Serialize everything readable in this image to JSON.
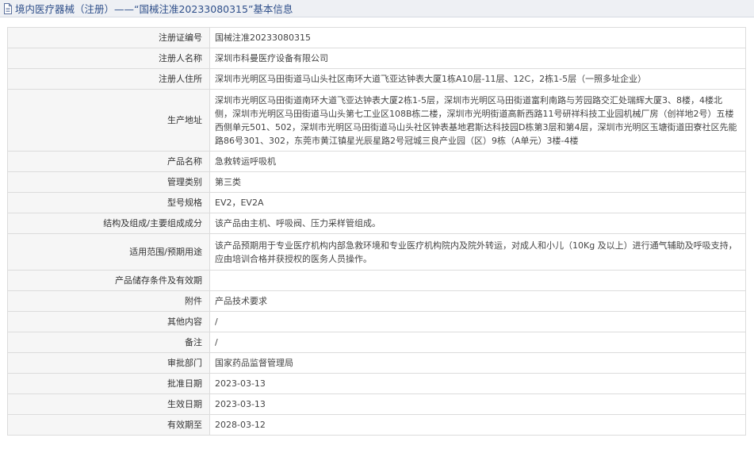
{
  "header": {
    "title": "境内医疗器械（注册）——“国械注准20233080315”基本信息",
    "icon": "document-icon"
  },
  "rows": [
    {
      "label": "注册证编号",
      "value": "国械注准20233080315"
    },
    {
      "label": "注册人名称",
      "value": "深圳市科曼医疗设备有限公司"
    },
    {
      "label": "注册人住所",
      "value": "深圳市光明区马田街道马山头社区南环大道飞亚达钟表大厦1栋A10层-11层、12C，2栋1-5层（一照多址企业）"
    },
    {
      "label": "生产地址",
      "value": "深圳市光明区马田街道南环大道飞亚达钟表大厦2栋1-5层，深圳市光明区马田街道富利南路与芳园路交汇处瑞辉大厦3、8楼，4楼北侧，深圳市光明区马田街道马山头第七工业区108B栋二楼，深圳市光明街道高新西路11号研祥科技工业园机械厂房（创祥地2号）五楼西侧单元501、502，深圳市光明区马田街道马山头社区钟表基地君斯达科技园D栋第3层和第4层，深圳市光明区玉塘街道田寮社区先能路86号301、302，东莞市黄江镇星光辰星路2号冠城三良产业园（区）9栋（A单元）3楼-4楼"
    },
    {
      "label": "产品名称",
      "value": "急救转运呼吸机"
    },
    {
      "label": "管理类别",
      "value": "第三类"
    },
    {
      "label": "型号规格",
      "value": "EV2，EV2A"
    },
    {
      "label": "结构及组成/主要组成成分",
      "value": "该产品由主机、呼吸阀、压力采样管组成。"
    },
    {
      "label": "适用范围/预期用途",
      "value": "该产品预期用于专业医疗机构内部急救环境和专业医疗机构院内及院外转运，对成人和小儿（10Kg 及以上）进行通气辅助及呼吸支持，应由培训合格并获授权的医务人员操作。"
    },
    {
      "label": "产品储存条件及有效期",
      "value": ""
    },
    {
      "label": "附件",
      "value": "产品技术要求"
    },
    {
      "label": "其他内容",
      "value": "/"
    },
    {
      "label": "备注",
      "value": "/"
    },
    {
      "label": "审批部门",
      "value": "国家药品监督管理局"
    },
    {
      "label": "批准日期",
      "value": "2023-03-13"
    },
    {
      "label": "生效日期",
      "value": "2023-03-13"
    },
    {
      "label": "有效期至",
      "value": "2028-03-12"
    }
  ]
}
